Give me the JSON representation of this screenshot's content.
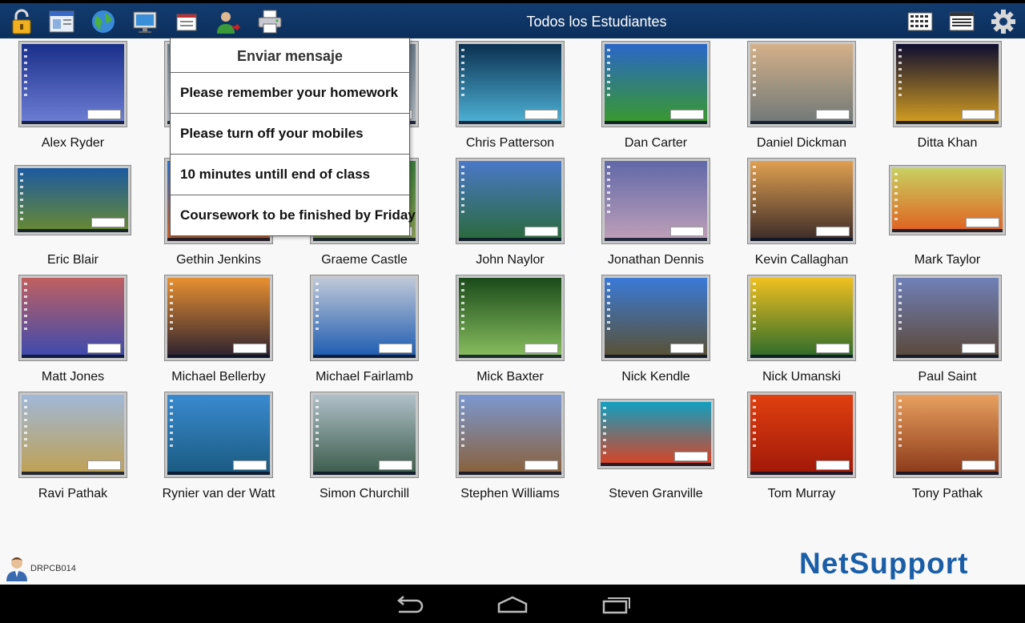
{
  "header": {
    "title": "Todos los Estudiantes",
    "left_icons": [
      "lock-icon",
      "window-icon",
      "globe-icon",
      "monitor-icon",
      "message-icon",
      "user-remove-icon",
      "printer-icon"
    ],
    "right_icons": [
      "thumbnail-grid-icon",
      "list-view-icon",
      "gear-icon"
    ]
  },
  "popup": {
    "title": "Enviar mensaje",
    "items": [
      "Please remember your homework",
      "Please turn off your mobiles",
      "10 minutes untill end of class",
      "Coursework to be finished by Friday"
    ]
  },
  "students": [
    {
      "name": "Alex Ryder",
      "bg": [
        "#1a2f8a",
        "#6f7fd6"
      ]
    },
    {
      "name": "",
      "bg": [
        "#6a7a88",
        "#b0b8c0"
      ]
    },
    {
      "name": "",
      "bg": [
        "#6a7a88",
        "#b0b8c0"
      ]
    },
    {
      "name": "Chris Patterson",
      "bg": [
        "#0a3050",
        "#4fb4d8"
      ]
    },
    {
      "name": "Dan Carter",
      "bg": [
        "#2a66c8",
        "#3a9a2a"
      ]
    },
    {
      "name": "Daniel Dickman",
      "bg": [
        "#d4b088",
        "#6e7878"
      ]
    },
    {
      "name": "Ditta Khan",
      "bg": [
        "#0d0d30",
        "#d8a020"
      ]
    },
    {
      "name": "Eric Blair",
      "bg": [
        "#1c5aa0",
        "#6a8a30"
      ]
    },
    {
      "name": "Gethin Jenkins",
      "bg": [
        "#2a70c8",
        "#d06020"
      ]
    },
    {
      "name": "Graeme Castle",
      "bg": [
        "#3a7a3a",
        "#8aa050"
      ]
    },
    {
      "name": "John Naylor",
      "bg": [
        "#4a78c8",
        "#2a6a3a"
      ]
    },
    {
      "name": "Jonathan Dennis",
      "bg": [
        "#6068a8",
        "#c0a0b8"
      ]
    },
    {
      "name": "Kevin Callaghan",
      "bg": [
        "#e0a050",
        "#3a2a28"
      ]
    },
    {
      "name": "Mark Taylor",
      "bg": [
        "#c8d060",
        "#e06020"
      ]
    },
    {
      "name": "Matt Jones",
      "bg": [
        "#c06060",
        "#3a4ab0"
      ]
    },
    {
      "name": "Michael Bellerby",
      "bg": [
        "#e89030",
        "#2a2030"
      ]
    },
    {
      "name": "Michael Fairlamb",
      "bg": [
        "#c0c8d8",
        "#1a5ab0"
      ]
    },
    {
      "name": "Mick Baxter",
      "bg": [
        "#1a4a1a",
        "#8ac060"
      ]
    },
    {
      "name": "Nick Kendle",
      "bg": [
        "#3a7ad8",
        "#5a5030"
      ]
    },
    {
      "name": "Nick Umanski",
      "bg": [
        "#f0c020",
        "#2a6a2a"
      ]
    },
    {
      "name": "Paul Saint",
      "bg": [
        "#7080b8",
        "#5a4838"
      ]
    },
    {
      "name": "Ravi Pathak",
      "bg": [
        "#a0b8d8",
        "#c0a050"
      ]
    },
    {
      "name": "Rynier van der Watt",
      "bg": [
        "#3a8ad0",
        "#1a5a80"
      ]
    },
    {
      "name": "Simon Churchill",
      "bg": [
        "#b0c0c8",
        "#3a5a4a"
      ]
    },
    {
      "name": "Stephen Williams",
      "bg": [
        "#7a98d0",
        "#8a6038"
      ]
    },
    {
      "name": "Steven Granville",
      "bg": [
        "#10a0c0",
        "#e04020"
      ]
    },
    {
      "name": "Tom Murray",
      "bg": [
        "#e04010",
        "#a01808"
      ]
    },
    {
      "name": "Tony Pathak",
      "bg": [
        "#e8a060",
        "#8a3818"
      ]
    }
  ],
  "footer": {
    "computer_name": "DRPCB014",
    "logo_text": "NetSupport"
  },
  "colors": {
    "topbar": "#123c70",
    "logo": "#1a5ea8"
  }
}
